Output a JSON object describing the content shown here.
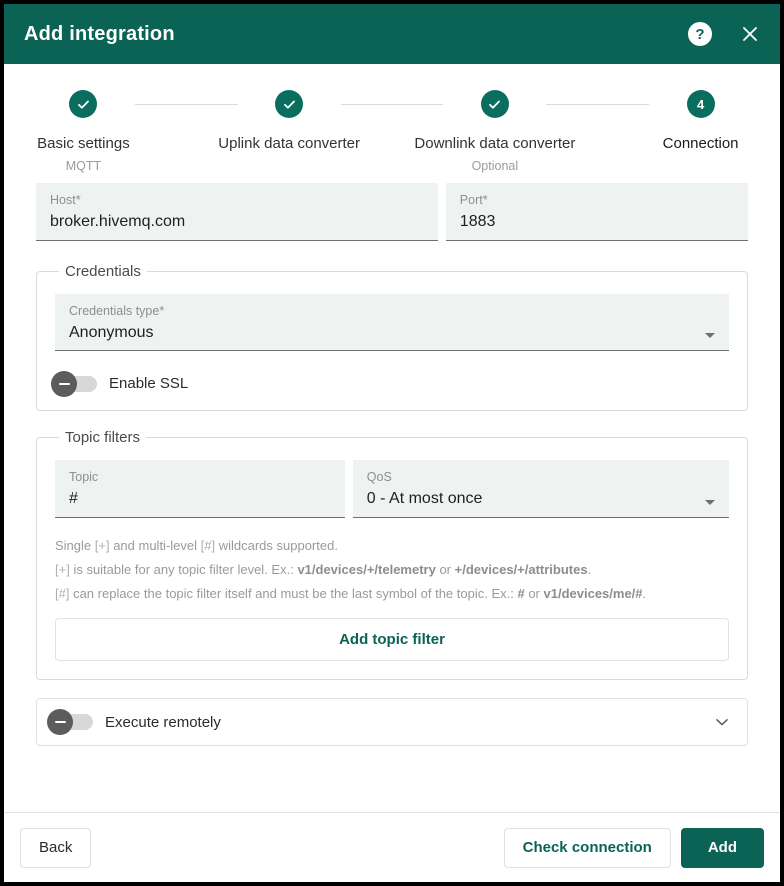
{
  "header": {
    "title": "Add integration",
    "help_icon": "help-circle-icon",
    "help_label": "?",
    "close_icon": "close-icon"
  },
  "stepper": {
    "steps": [
      {
        "label": "Basic settings",
        "sub": "MQTT",
        "state": "completed",
        "marker": "check"
      },
      {
        "label": "Uplink data converter",
        "sub": "",
        "state": "completed",
        "marker": "check"
      },
      {
        "label": "Downlink data converter",
        "sub": "Optional",
        "state": "completed",
        "marker": "check"
      },
      {
        "label": "Connection",
        "sub": "",
        "state": "active",
        "marker": "4"
      }
    ]
  },
  "form": {
    "host": {
      "label": "Host*",
      "value": "broker.hivemq.com"
    },
    "port": {
      "label": "Port*",
      "value": "1883"
    },
    "credentials": {
      "legend": "Credentials",
      "type": {
        "label": "Credentials type*",
        "value": "Anonymous"
      },
      "enable_ssl": {
        "label": "Enable SSL",
        "state": "off"
      }
    },
    "topic_filters": {
      "legend": "Topic filters",
      "topic": {
        "label": "Topic",
        "value": "#"
      },
      "qos": {
        "label": "QoS",
        "value": "0 - At most once"
      },
      "hints": [
        "Single [+] and multi-level [#] wildcards supported.",
        "[+] is suitable for any topic filter level. Ex.: v1/devices/+/telemetry or +/devices/+/attributes.",
        "[#] can replace the topic filter itself and must be the last symbol of the topic. Ex.: # or v1/devices/me/#."
      ],
      "hint_parts": {
        "l1_a": "Single ",
        "l1_wc1": "[+]",
        "l1_b": " and multi-level ",
        "l1_wc2": "[#]",
        "l1_c": " wildcards supported.",
        "l2_wc": "[+]",
        "l2_a": " is suitable for any topic filter level. Ex.: ",
        "l2_b1": "v1/devices/+/telemetry",
        "l2_mid": " or ",
        "l2_b2": "+/devices/+/attributes",
        "l2_end": ".",
        "l3_wc": "[#]",
        "l3_a": " can replace the topic filter itself and must be the last symbol of the topic. Ex.: ",
        "l3_b1": "#",
        "l3_mid": " or ",
        "l3_b2": "v1/devices/me/#",
        "l3_end": "."
      },
      "add_button": "Add topic filter"
    },
    "execute_remotely": {
      "label": "Execute remotely",
      "state": "off",
      "chevron": "chevron-down-icon"
    }
  },
  "footer": {
    "back": "Back",
    "check_connection": "Check connection",
    "add": "Add"
  },
  "colors": {
    "brand": "#0a6355",
    "step_active": "#0a6e5e",
    "field_bg": "#eef3f2",
    "accent_text": "#0a6355"
  }
}
